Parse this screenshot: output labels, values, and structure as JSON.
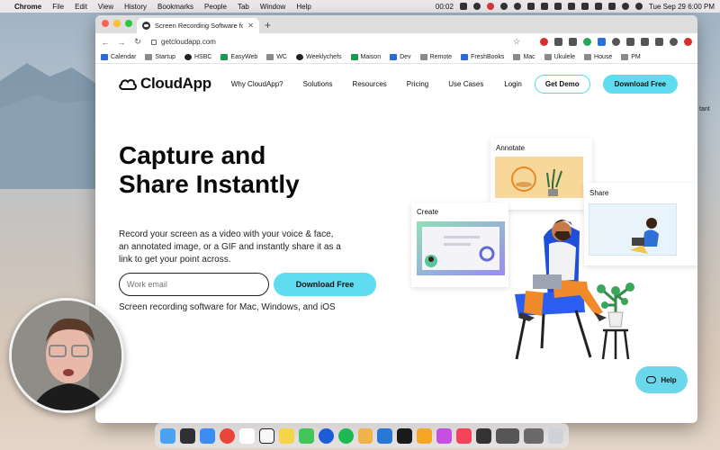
{
  "menubar": {
    "app": "Chrome",
    "items": [
      "File",
      "Edit",
      "View",
      "History",
      "Bookmarks",
      "People",
      "Tab",
      "Window",
      "Help"
    ],
    "recording_time": "00:02",
    "datetime": "Tue Sep 29  6:00 PM"
  },
  "browser": {
    "tab_title": "Screen Recording Software for",
    "url": "getcloudapp.com",
    "bookmarks": [
      "Calendar",
      "Startup",
      "HSBC",
      "EasyWeb",
      "WC",
      "Weeklychefs",
      "Maison",
      "Dev",
      "Remote",
      "FreshBooks",
      "Mac",
      "Ukulele",
      "House",
      "PM"
    ]
  },
  "site": {
    "logo": "CloudApp",
    "nav": [
      "Why CloudApp?",
      "Solutions",
      "Resources",
      "Pricing",
      "Use Cases"
    ],
    "login": "Login",
    "get_demo": "Get Demo",
    "download": "Download Free",
    "hero_title": "Capture and Share Instantly",
    "hero_sub": "Record your screen as a video with your voice & face, an annotated image, or a GIF and instantly share it as a link to get your point across.",
    "email_placeholder": "Work email",
    "download_cta": "Download Free",
    "platforms": "Screen recording software for Mac, Windows, and iOS",
    "card_annotate": "Annotate",
    "card_share": "Share",
    "card_create": "Create",
    "help": "Help"
  },
  "desktop": {
    "side_text": "tant"
  },
  "colors": {
    "accent": "#5fdcef",
    "window_bg": "#ffffff"
  }
}
